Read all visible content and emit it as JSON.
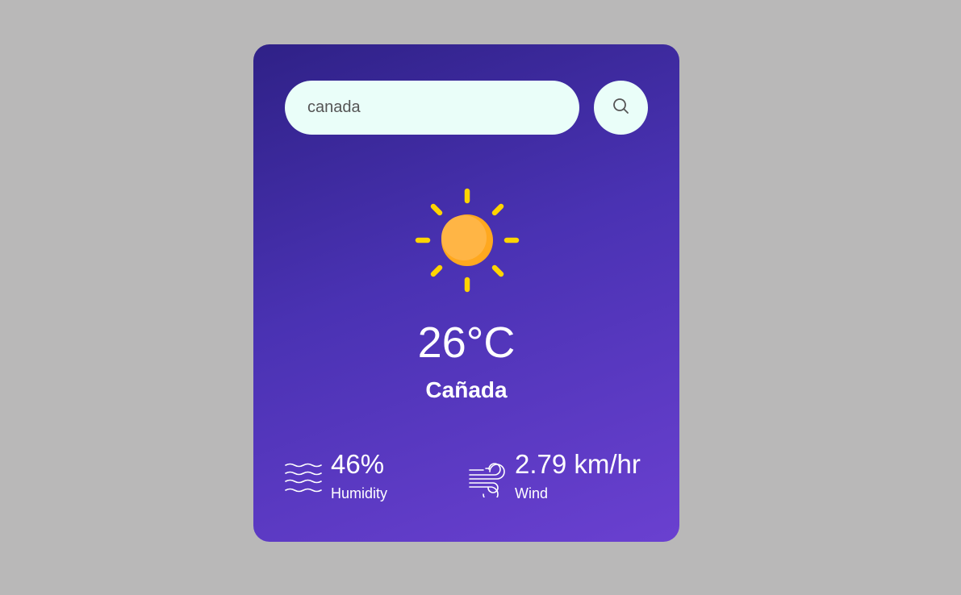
{
  "search": {
    "value": "canada",
    "button_icon": "search-icon"
  },
  "weather": {
    "icon": "sun-icon",
    "temperature": "26°C",
    "city": "Cañada"
  },
  "details": {
    "humidity": {
      "icon": "humidity-waves-icon",
      "value": "46%",
      "label": "Humidity"
    },
    "wind": {
      "icon": "wind-icon",
      "value": "2.79 km/hr",
      "label": "Wind"
    }
  },
  "colors": {
    "page_background": "#b9b8b8",
    "card_gradient_top": "#2f2187",
    "card_gradient_bottom": "#6a40d0",
    "search_background": "#eafef9",
    "sun_body": "#ffb23f",
    "sun_rays": "#ffd400",
    "text": "#ffffff"
  }
}
